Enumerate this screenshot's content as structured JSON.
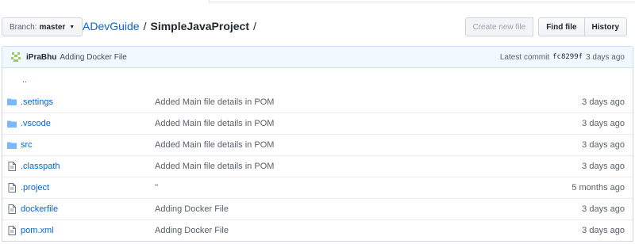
{
  "branch": {
    "label": "Branch:",
    "value": "master"
  },
  "breadcrumb": {
    "repo": "ADevGuide",
    "dir": "SimpleJavaProject",
    "sep1": "/",
    "sep2": "/"
  },
  "file_nav": {
    "create": "Create new file",
    "find": "Find file",
    "history": "History"
  },
  "commit": {
    "author": "iPraBhu",
    "message": "Adding Docker File",
    "latest_label": "Latest commit",
    "sha": "fc8299f",
    "when": "3 days ago"
  },
  "up_link": "..",
  "files": [
    {
      "name": ".settings",
      "type": "dir",
      "message": "Added Main file details in POM",
      "age": "3 days ago"
    },
    {
      "name": ".vscode",
      "type": "dir",
      "message": "Added Main file details in POM",
      "age": "3 days ago"
    },
    {
      "name": "src",
      "type": "dir",
      "message": "Added Main file details in POM",
      "age": "3 days ago"
    },
    {
      "name": ".classpath",
      "type": "file",
      "message": "Added Main file details in POM",
      "age": "3 days ago"
    },
    {
      "name": ".project",
      "type": "file",
      "message": "''",
      "age": "5 months ago"
    },
    {
      "name": "dockerfile",
      "type": "file",
      "message": "Adding Docker File",
      "age": "3 days ago"
    },
    {
      "name": "pom.xml",
      "type": "file",
      "message": "Adding Docker File",
      "age": "3 days ago"
    }
  ],
  "colors": {
    "link": "#0366d6",
    "folder": "#79b8ff",
    "commit_bg": "#f1f8ff"
  },
  "icons": {
    "dir": "folder-icon",
    "file": "file-icon",
    "branch_caret": "caret-down-icon",
    "avatar": "identicon-avatar"
  }
}
